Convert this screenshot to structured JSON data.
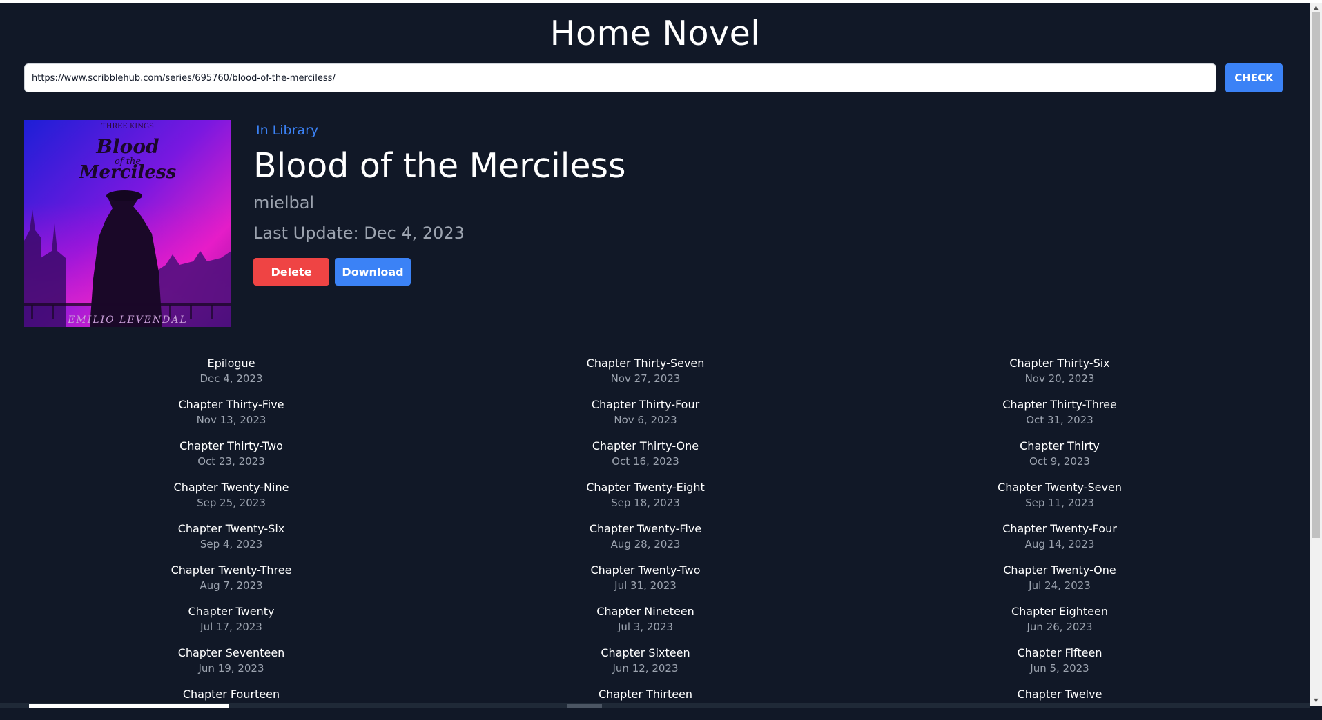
{
  "header": {
    "title": "Home Novel"
  },
  "search": {
    "url_value": "https://www.scribblehub.com/series/695760/blood-of-the-merciless/",
    "check_label": "CHECK"
  },
  "novel": {
    "status": "In Library",
    "title": "Blood of the Merciless",
    "author": "mielbal",
    "last_update": "Last Update: Dec 4, 2023",
    "cover": {
      "series_text": "THREE KINGS",
      "title_line1": "Blood",
      "title_line2": "of the",
      "title_line3": "Merciless",
      "author_text": "EMILIO LEVENDAL"
    },
    "delete_label": "Delete",
    "download_label": "Download"
  },
  "chapters": [
    {
      "title": "Epilogue",
      "date": "Dec 4, 2023"
    },
    {
      "title": "Chapter Thirty-Seven",
      "date": "Nov 27, 2023"
    },
    {
      "title": "Chapter Thirty-Six",
      "date": "Nov 20, 2023"
    },
    {
      "title": "Chapter Thirty-Five",
      "date": "Nov 13, 2023"
    },
    {
      "title": "Chapter Thirty-Four",
      "date": "Nov 6, 2023"
    },
    {
      "title": "Chapter Thirty-Three",
      "date": "Oct 31, 2023"
    },
    {
      "title": "Chapter Thirty-Two",
      "date": "Oct 23, 2023"
    },
    {
      "title": "Chapter Thirty-One",
      "date": "Oct 16, 2023"
    },
    {
      "title": "Chapter Thirty",
      "date": "Oct 9, 2023"
    },
    {
      "title": "Chapter Twenty-Nine",
      "date": "Sep 25, 2023"
    },
    {
      "title": "Chapter Twenty-Eight",
      "date": "Sep 18, 2023"
    },
    {
      "title": "Chapter Twenty-Seven",
      "date": "Sep 11, 2023"
    },
    {
      "title": "Chapter Twenty-Six",
      "date": "Sep 4, 2023"
    },
    {
      "title": "Chapter Twenty-Five",
      "date": "Aug 28, 2023"
    },
    {
      "title": "Chapter Twenty-Four",
      "date": "Aug 14, 2023"
    },
    {
      "title": "Chapter Twenty-Three",
      "date": "Aug 7, 2023"
    },
    {
      "title": "Chapter Twenty-Two",
      "date": "Jul 31, 2023"
    },
    {
      "title": "Chapter Twenty-One",
      "date": "Jul 24, 2023"
    },
    {
      "title": "Chapter Twenty",
      "date": "Jul 17, 2023"
    },
    {
      "title": "Chapter Nineteen",
      "date": "Jul 3, 2023"
    },
    {
      "title": "Chapter Eighteen",
      "date": "Jun 26, 2023"
    },
    {
      "title": "Chapter Seventeen",
      "date": "Jun 19, 2023"
    },
    {
      "title": "Chapter Sixteen",
      "date": "Jun 12, 2023"
    },
    {
      "title": "Chapter Fifteen",
      "date": "Jun 5, 2023"
    },
    {
      "title": "Chapter Fourteen",
      "date": ""
    },
    {
      "title": "Chapter Thirteen",
      "date": ""
    },
    {
      "title": "Chapter Twelve",
      "date": ""
    }
  ],
  "colors": {
    "background": "#111827",
    "accent": "#3b82f6",
    "danger": "#ef4444",
    "muted_text": "#9ca3af"
  }
}
